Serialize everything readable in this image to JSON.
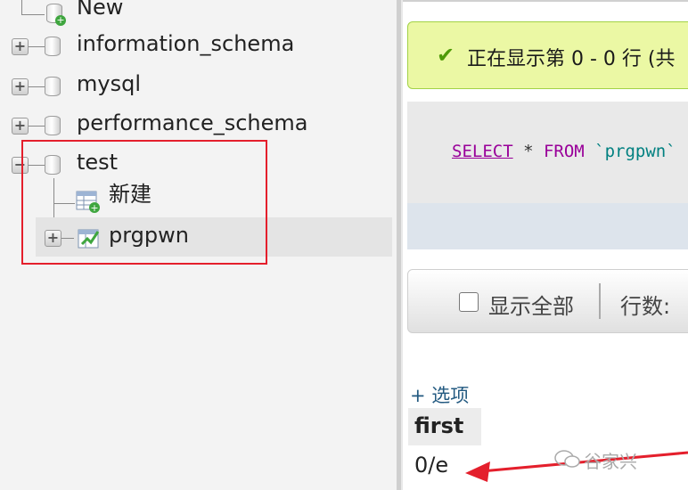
{
  "nav": {
    "new_label": "New",
    "databases": [
      {
        "name": "information_schema"
      },
      {
        "name": "mysql"
      },
      {
        "name": "performance_schema"
      },
      {
        "name": "test"
      }
    ],
    "test_children": {
      "new_table_label": "新建",
      "table_name": "prgpwn"
    }
  },
  "main": {
    "success_message": "正在显示第 0 - 0 行 (共",
    "sql": {
      "select": "SELECT",
      "star": " * ",
      "from": "FROM",
      "table": " `prgpwn`"
    },
    "navbar": {
      "show_all_label": "显示全部",
      "rows_label": "行数:"
    },
    "options_link": "+ 选项",
    "column_header": "first",
    "cell_value": "0/e"
  },
  "watermark": "谷家兴",
  "colors": {
    "highlight": "#e41f2c",
    "success_bg": "#ebf8a4",
    "sql_keyword": "#990099"
  }
}
